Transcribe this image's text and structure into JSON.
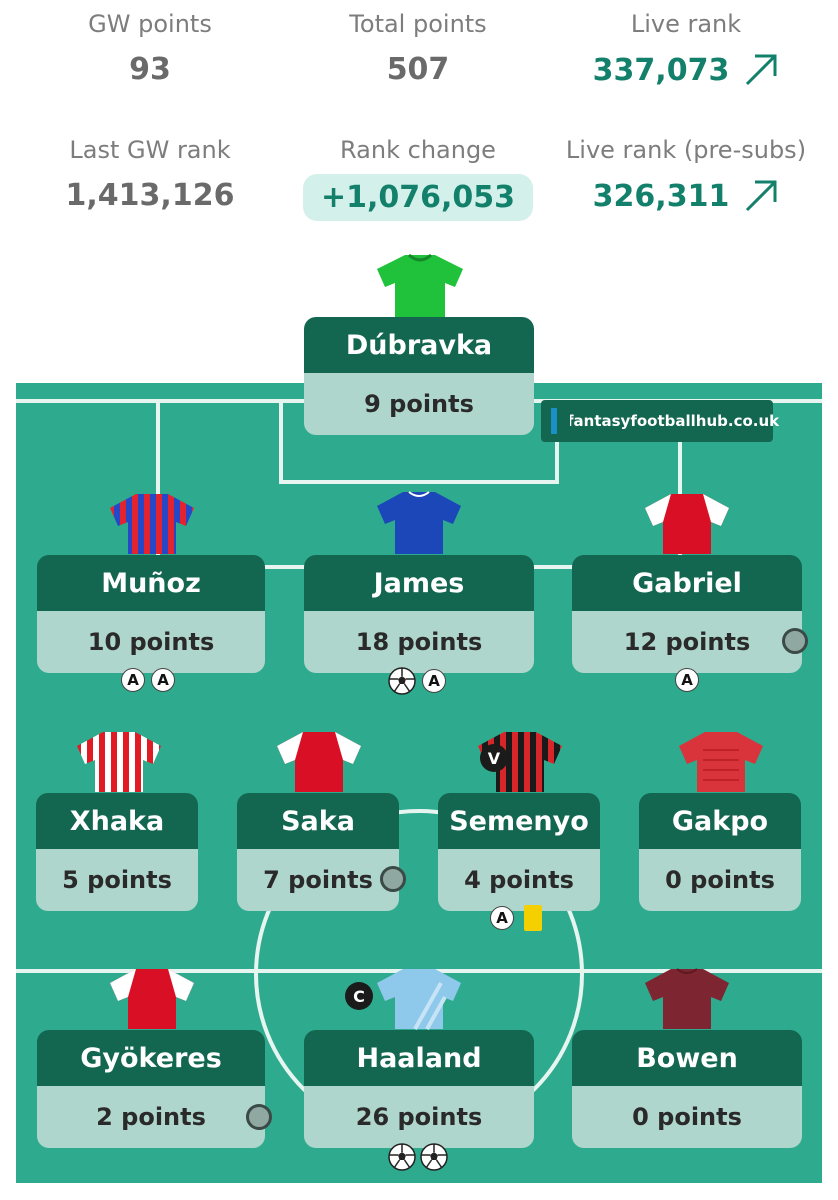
{
  "stats": {
    "gw_points": {
      "label": "GW points",
      "value": "93"
    },
    "total_points": {
      "label": "Total points",
      "value": "507"
    },
    "live_rank": {
      "label": "Live rank",
      "value": "337,073"
    },
    "last_gw_rank": {
      "label": "Last GW rank",
      "value": "1,413,126"
    },
    "rank_change": {
      "label": "Rank change",
      "value": "+1,076,053"
    },
    "live_rank_presubs": {
      "label": "Live rank (pre-subs)",
      "value": "326,311"
    }
  },
  "brand": {
    "text": "fantasyfootballhub.co.uk"
  },
  "colors": {
    "card_header": "#13664f",
    "card_body": "#afd6cc",
    "pitch": "#2eab8e",
    "accent_green": "#12806a",
    "pill_bg": "#d3f1ea"
  },
  "players": {
    "dubravka": {
      "name": "Dúbravka",
      "points": "9 points"
    },
    "munoz": {
      "name": "Muñoz",
      "points": "10 points",
      "badges": [
        "A",
        "A"
      ]
    },
    "james": {
      "name": "James",
      "points": "18 points",
      "badges": [
        "A"
      ]
    },
    "gabriel": {
      "name": "Gabriel",
      "points": "12 points",
      "badges": [
        "A"
      ]
    },
    "xhaka": {
      "name": "Xhaka",
      "points": "5 points"
    },
    "saka": {
      "name": "Saka",
      "points": "7 points"
    },
    "semenyo": {
      "name": "Semenyo",
      "points": "4 points",
      "badges": [
        "A"
      ],
      "role": "V"
    },
    "gakpo": {
      "name": "Gakpo",
      "points": "0 points"
    },
    "gyokeres": {
      "name": "Gyökeres",
      "points": "2 points"
    },
    "haaland": {
      "name": "Haaland",
      "points": "26 points",
      "role": "C"
    },
    "bowen": {
      "name": "Bowen",
      "points": "0 points"
    }
  }
}
